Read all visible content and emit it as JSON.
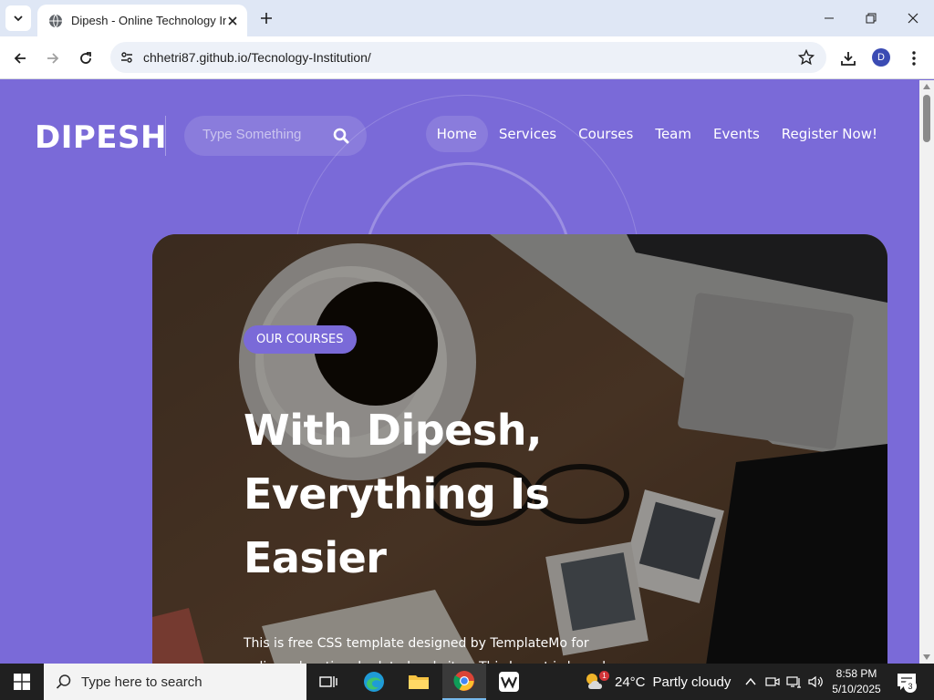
{
  "browser": {
    "tab_title": "Dipesh - Online Technology Institute",
    "url": "chhetri87.github.io/Tecnology-Institution/",
    "profile_initial": "D"
  },
  "site": {
    "logo": "DIPESH",
    "search_placeholder": "Type Something",
    "nav": [
      "Home",
      "Services",
      "Courses",
      "Team",
      "Events",
      "Register Now!"
    ],
    "active_nav": "Home",
    "accent_color": "#7a6ad8"
  },
  "hero": {
    "badge": "OUR COURSES",
    "title_lines": [
      "With Dipesh,",
      "Everything Is",
      "Easier"
    ],
    "description": "This is free CSS template designed by TemplateMo for online educational related websites. This layout is based"
  },
  "taskbar": {
    "search_placeholder": "Type here to search",
    "weather_temp": "24°C",
    "weather_text": "Partly cloudy",
    "weather_badge": "1",
    "time": "8:58 PM",
    "date": "5/10/2025",
    "notification_count": "3"
  }
}
